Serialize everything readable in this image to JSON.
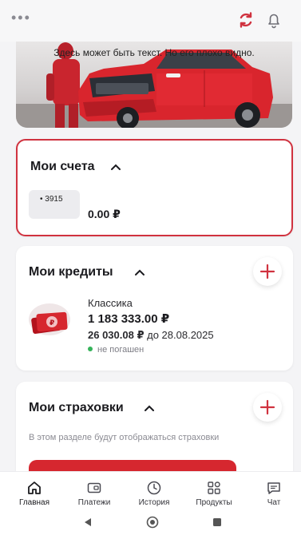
{
  "top": {
    "menu_icon": "dots-icon",
    "refresh_icon": "refresh-icon",
    "bell_icon": "bell-icon",
    "accent_color": "#d0323f"
  },
  "banner": {
    "text": "Здесь может быть текст. Но его плохо видно."
  },
  "accounts": {
    "title": "Мои счета",
    "items": [
      {
        "number": "• 3915",
        "balance": "0.00 ₽"
      }
    ]
  },
  "credits": {
    "title": "Мои кредиты",
    "items": [
      {
        "name": "Классика",
        "amount": "1 183 333.00 ₽",
        "payment_amount": "26 030.08 ₽",
        "payment_date": "до 28.08.2025",
        "status": "не погашен",
        "status_color": "#35b35a"
      }
    ]
  },
  "insurance": {
    "title": "Мои страховки",
    "hint": "В этом разделе будут отображаться страховки"
  },
  "tabbar": {
    "tabs": [
      {
        "label": "Главная",
        "icon": "home-icon",
        "active": true
      },
      {
        "label": "Платежи",
        "icon": "wallet-icon"
      },
      {
        "label": "История",
        "icon": "clock-icon"
      },
      {
        "label": "Продукты",
        "icon": "grid-icon"
      },
      {
        "label": "Чат",
        "icon": "chat-icon"
      }
    ]
  },
  "system_nav": {
    "back_icon": "back-icon",
    "home_icon": "home-circle-icon",
    "recents_icon": "recents-icon"
  }
}
